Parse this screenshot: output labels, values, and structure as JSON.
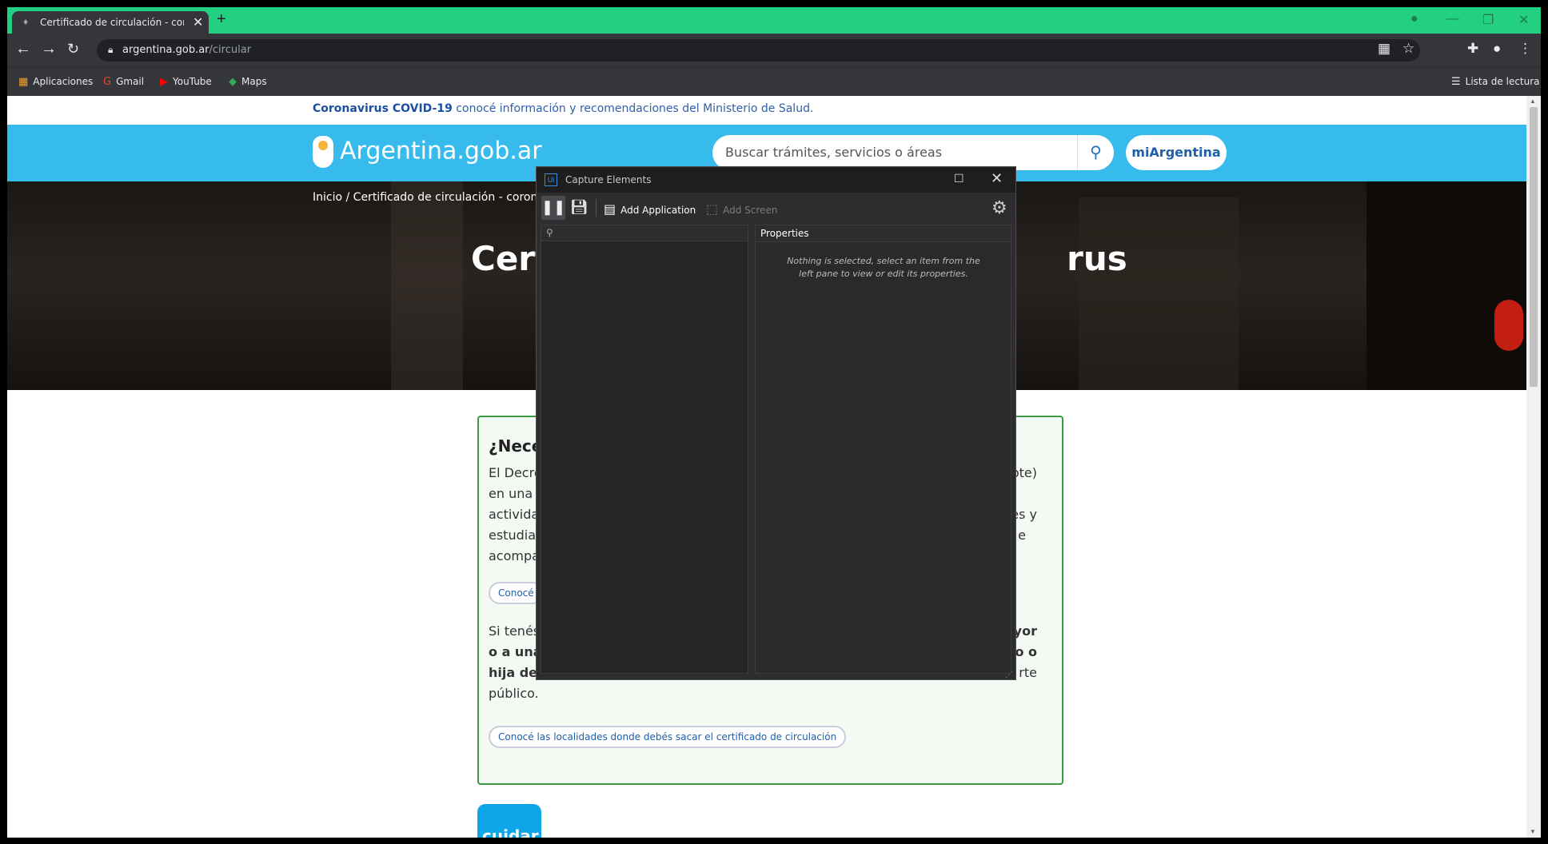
{
  "browser": {
    "tab_title": "Certificado de circulación - coronavirus",
    "tab_close": "✕",
    "new_tab": "+",
    "url_host": "argentina.gob.ar",
    "url_path": "/circular",
    "accent_color": "#23d082"
  },
  "bookmarks": {
    "items": [
      "Aplicaciones",
      "Gmail",
      "YouTube",
      "Maps"
    ],
    "reading_list": "Lista de lectura"
  },
  "site": {
    "alert_bold": "Coronavirus COVID-19",
    "alert_text": " conocé información y recomendaciones del Ministerio de Salud.",
    "logo_text": "Argentina.gob.ar",
    "search_placeholder": "Buscar trámites, servicios o áreas",
    "account_button": "miArgentina",
    "breadcrumb_home": "Inicio",
    "breadcrumb_sep": "/",
    "breadcrumb_current": "Certificado de circulación - coronavir",
    "hero_title_left": "Cert",
    "hero_title_right": "rus",
    "card_heading": "¿Nece",
    "card_p1_l1": "El Decre",
    "card_p1_l1_right": "ote)",
    "card_p1_l2": "en una l",
    "card_p1_l3": "activida",
    "card_p1_l3_right": "tes y",
    "card_p1_l4": "estudiar",
    "card_p1_l4_right": "e",
    "card_p1_l5": "acompa",
    "card_pill1": "Conocé",
    "card_p2_l1": "Si tenés",
    "card_p2_l1_right": "nayor",
    "card_p2_l2": "o a una",
    "card_p2_l2_right": "ijo o",
    "card_p2_l3": "hija de",
    "card_p2_l3_right": "rte",
    "card_p2_l4": "público.",
    "card_pill2": "Conocé las localidades donde debés sacar el certificado de circulación",
    "cuidar_label": "cuidar"
  },
  "capture_window": {
    "title": "Capture Elements",
    "add_application": "Add Application",
    "add_screen": "Add Screen",
    "properties_header": "Properties",
    "empty_message": "Nothing is selected, select an item from the left pane to view or edit its properties."
  }
}
